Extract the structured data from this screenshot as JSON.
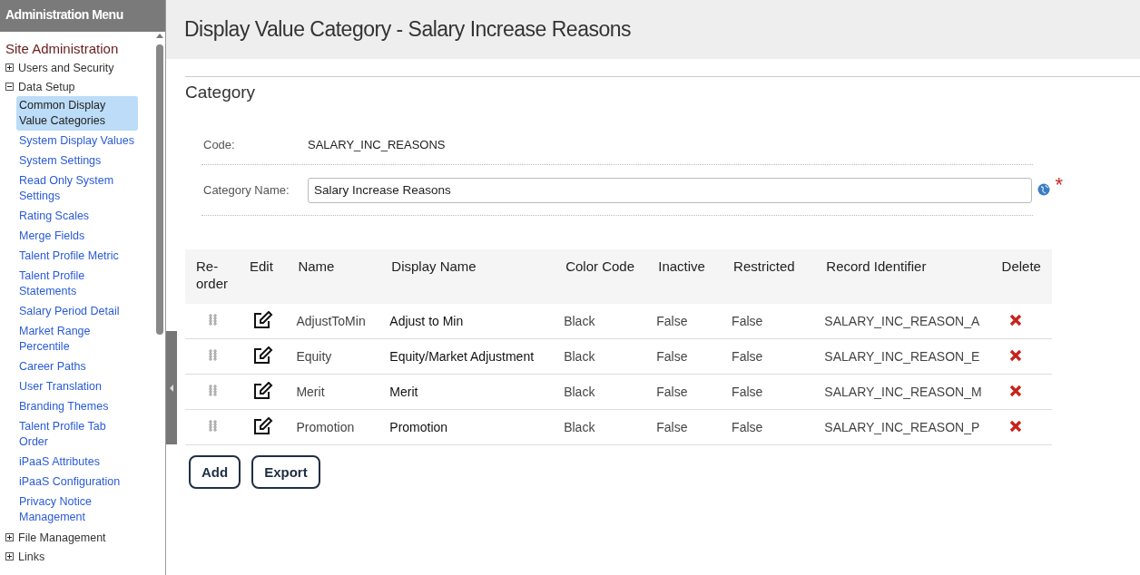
{
  "sidebar": {
    "title": "Administration Menu",
    "section": "Site Administration",
    "items": [
      {
        "label": "Users and Security",
        "expanded": false
      },
      {
        "label": "Data Setup",
        "expanded": true,
        "children": [
          {
            "label": "Common Display Value Categories",
            "selected": true
          },
          {
            "label": "System Display Values",
            "selected": false
          },
          {
            "label": "System Settings",
            "selected": false
          },
          {
            "label": "Read Only System Settings",
            "selected": false
          },
          {
            "label": "Rating Scales",
            "selected": false
          },
          {
            "label": "Merge Fields",
            "selected": false
          },
          {
            "label": "Talent Profile Metric",
            "selected": false
          },
          {
            "label": "Talent Profile Statements",
            "selected": false
          },
          {
            "label": "Salary Period Detail",
            "selected": false
          },
          {
            "label": "Market Range Percentile",
            "selected": false
          },
          {
            "label": "Career Paths",
            "selected": false
          },
          {
            "label": "User Translation",
            "selected": false
          },
          {
            "label": "Branding Themes",
            "selected": false
          },
          {
            "label": "Talent Profile Tab Order",
            "selected": false
          },
          {
            "label": "iPaaS Attributes",
            "selected": false
          },
          {
            "label": "iPaaS Configuration",
            "selected": false
          },
          {
            "label": "Privacy Notice Management",
            "selected": false
          }
        ]
      },
      {
        "label": "File Management",
        "expanded": false
      },
      {
        "label": "Links",
        "expanded": false
      }
    ]
  },
  "page_title": "Display Value Category - Salary Increase Reasons",
  "section_title": "Category",
  "form": {
    "code_label": "Code:",
    "code_value": "SALARY_INC_REASONS",
    "name_label": "Category Name:",
    "name_value": "Salary Increase Reasons",
    "required_mark": "*"
  },
  "table": {
    "columns": [
      "Re-order",
      "Edit",
      "Name",
      "Display Name",
      "Color Code",
      "Inactive",
      "Restricted",
      "Record Identifier",
      "Delete"
    ],
    "rows": [
      {
        "name": "AdjustToMin",
        "display_name": "Adjust to Min",
        "color_code": "Black",
        "inactive": "False",
        "restricted": "False",
        "record_identifier": "SALARY_INC_REASON_A"
      },
      {
        "name": "Equity",
        "display_name": "Equity/Market Adjustment",
        "color_code": "Black",
        "inactive": "False",
        "restricted": "False",
        "record_identifier": "SALARY_INC_REASON_E"
      },
      {
        "name": "Merit",
        "display_name": "Merit",
        "color_code": "Black",
        "inactive": "False",
        "restricted": "False",
        "record_identifier": "SALARY_INC_REASON_M"
      },
      {
        "name": "Promotion",
        "display_name": "Promotion",
        "color_code": "Black",
        "inactive": "False",
        "restricted": "False",
        "record_identifier": "SALARY_INC_REASON_P"
      }
    ]
  },
  "buttons": [
    "Add",
    "Export"
  ]
}
